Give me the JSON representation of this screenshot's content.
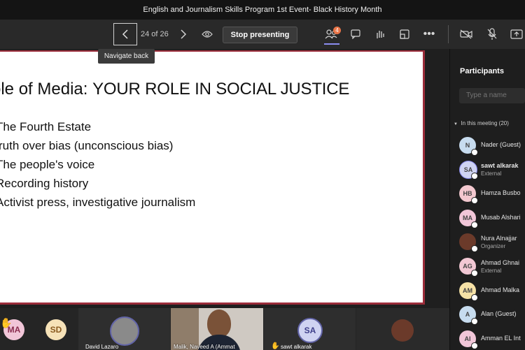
{
  "window": {
    "title": "English and Journalism Skills Program 1st Event- Black History Month"
  },
  "toolbar": {
    "page_counter": "24 of 26",
    "stop_presenting": "Stop presenting",
    "participants_badge": "4",
    "tooltip": "Navigate back"
  },
  "slide": {
    "title_prefix": "ole of Media: ",
    "title_main": "YOUR ROLE IN SOCIAL JUSTICE",
    "bullets": [
      "The Fourth Estate",
      "ruth over bias (unconscious bias)",
      "The people's voice",
      "Recording history",
      "Activist press, investigative journalism"
    ]
  },
  "panel": {
    "title": "Participants",
    "search_placeholder": "Type a name",
    "meeting_header": "In this meeting (20)",
    "participants": [
      {
        "initials": "N",
        "name": "Nader (Guest)",
        "sub": "",
        "color": "#c7dcef"
      },
      {
        "initials": "SA",
        "name": "sawt alkarak",
        "sub": "External",
        "color": "#cfd3f2"
      },
      {
        "initials": "HB",
        "name": "Hamza Busbo",
        "sub": "",
        "color": "#f3c8cf"
      },
      {
        "initials": "MA",
        "name": "Musab Alshari",
        "sub": "",
        "color": "#f1c6d8"
      },
      {
        "initials": "",
        "name": "Nura Alnajjar",
        "sub": "Organizer",
        "color": "#6b3a2a"
      },
      {
        "initials": "AG",
        "name": "Ahmad Ghnai",
        "sub": "External",
        "color": "#f2c8d4"
      },
      {
        "initials": "AM",
        "name": "Ahmad Malka",
        "sub": "",
        "color": "#f6e2a6"
      },
      {
        "initials": "A",
        "name": "Alan (Guest)",
        "sub": "",
        "color": "#c7dcef"
      },
      {
        "initials": "AI",
        "name": "Amman EL Int",
        "sub": "",
        "color": "#f1c6d8"
      }
    ]
  },
  "video_strip": {
    "tiles": [
      {
        "initials": "MA",
        "label": ""
      },
      {
        "initials": "SD",
        "label": ""
      },
      {
        "initials": "",
        "label": "David Lazaro"
      },
      {
        "initials": "",
        "label": "Malik, Naveed A (Ammat"
      },
      {
        "initials": "SA",
        "label": "sawt alkarak"
      },
      {
        "initials": "",
        "label": ""
      }
    ]
  }
}
